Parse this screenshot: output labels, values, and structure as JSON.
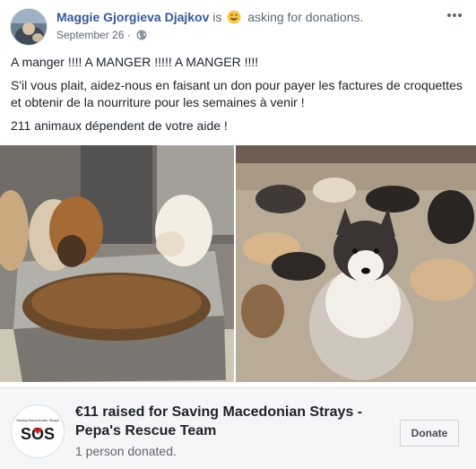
{
  "post": {
    "author": "Maggie Gjorgieva Djajkov",
    "is_text": "is",
    "feeling_icon": "smiling-face-icon",
    "activity": "asking for donations.",
    "date": "September 26",
    "date_separator": "·",
    "privacy_icon": "globe-icon",
    "text_lines": [
      "A manger !!!! A MANGER !!!!! A MANGER !!!!",
      "S'il vous plait, aidez-nous en faisant un don pour payer les factures de croquettes et obtenir de la nourriture pour les semaines à venir !",
      "211 animaux dépendent de votre aide !"
    ]
  },
  "fundraiser": {
    "title": "€11 raised for Saving Macedonian Strays - Pepa's Rescue Team",
    "count": "1 person donated.",
    "donate_label": "Donate",
    "logo_text": "SOS",
    "logo_caption": "Saving Macedonian Strays"
  },
  "colors": {
    "link": "#385898",
    "text": "#1d2129",
    "muted": "#606770",
    "panel": "#f5f6f7"
  }
}
